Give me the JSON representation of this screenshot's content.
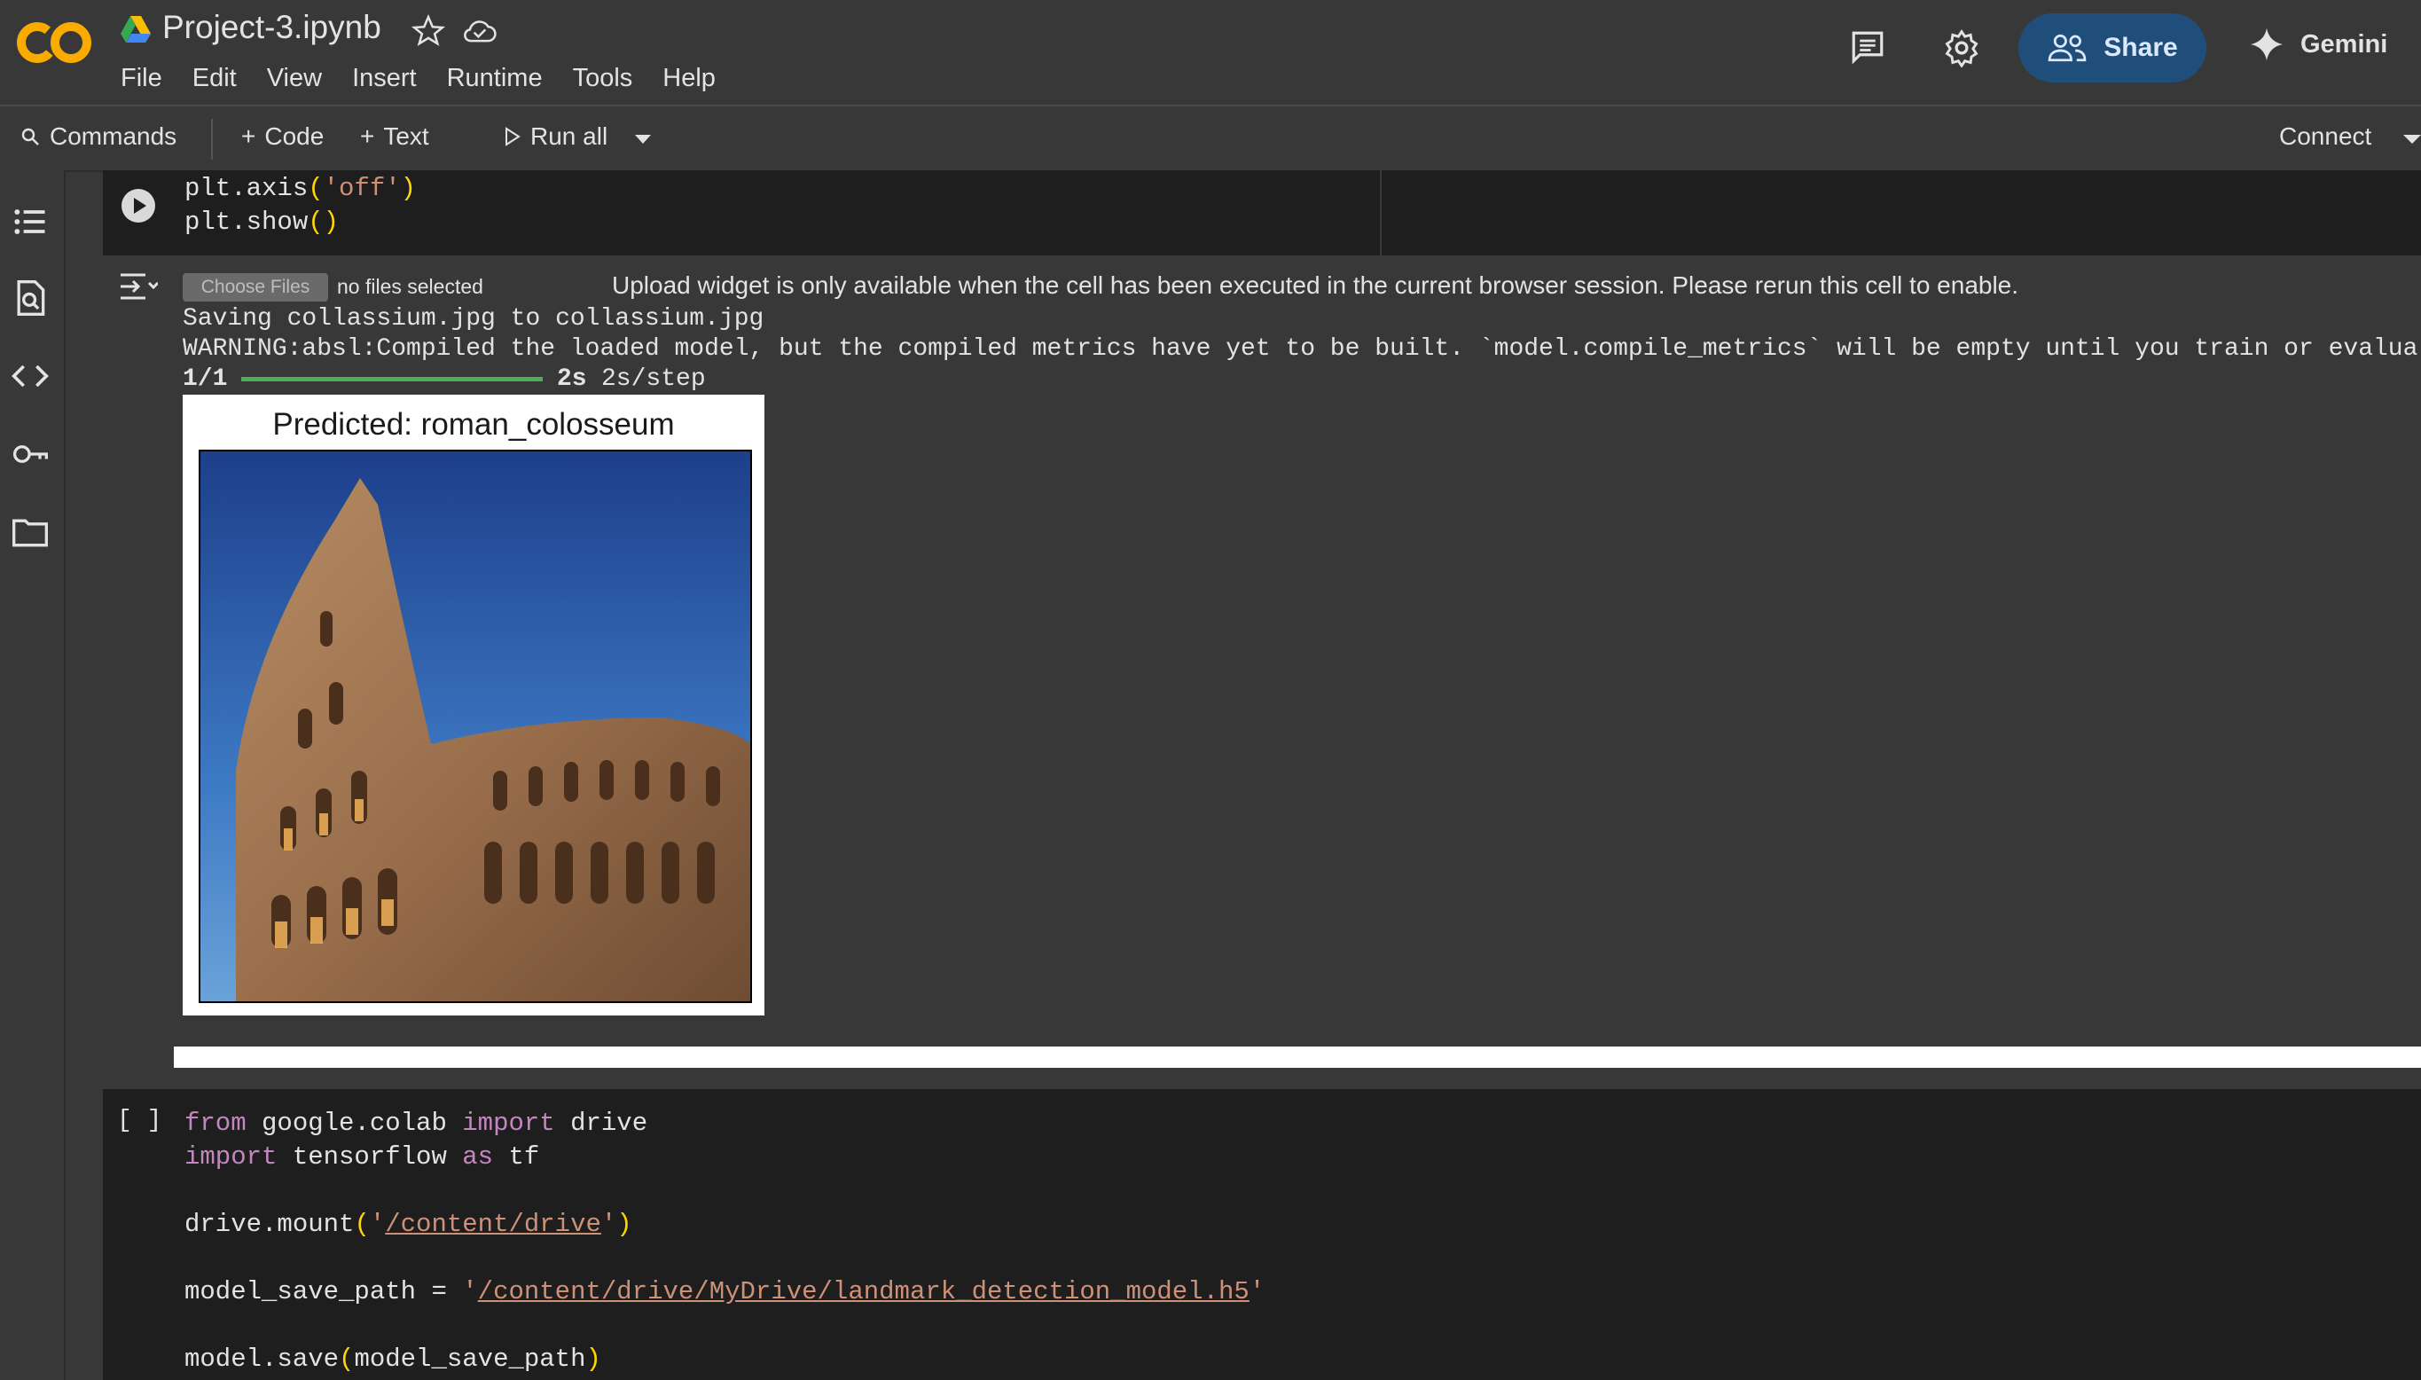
{
  "app": {
    "title": "Project-3.ipynb",
    "logo_text": "CO"
  },
  "menu": [
    "File",
    "Edit",
    "View",
    "Insert",
    "Runtime",
    "Tools",
    "Help"
  ],
  "header_actions": {
    "share_label": "Share",
    "gemini_label": "Gemini"
  },
  "toolbar": {
    "commands_label": "Commands",
    "code_label": "Code",
    "text_label": "Text",
    "run_all_label": "Run all",
    "connect_label": "Connect"
  },
  "sidebar_icons": [
    "table-of-contents-icon",
    "find-icon",
    "code-snippets-icon",
    "secrets-key-icon",
    "files-folder-icon"
  ],
  "cell1": {
    "lines": [
      "plt.axis('off')",
      "plt.show()"
    ]
  },
  "output": {
    "choose_files_label": "Choose Files",
    "no_files_text": "no files selected",
    "upload_message": "Upload widget is only available when the cell has been executed in the current browser session. Please rerun this cell to enable.",
    "saving_line": "Saving collassium.jpg to collassium.jpg",
    "warning_line": "WARNING:absl:Compiled the loaded model, but the compiled metrics have yet to be built. `model.compile_metrics` will be empty until you train or evalua",
    "progress_count": "1/1",
    "progress_fraction": 1.0,
    "progress_time": "2s",
    "progress_step": "2s/step",
    "figure_title": "Predicted: roman_colosseum"
  },
  "cell2": {
    "run_brackets": "[ ]",
    "lines": [
      "from google.colab import drive",
      "import tensorflow as tf",
      "",
      "drive.mount('/content/drive')",
      "",
      "model_save_path = '/content/drive/MyDrive/landmark_detection_model.h5'",
      "",
      "model.save(model_save_path)"
    ]
  },
  "colors": {
    "background": "#383838",
    "cell_bg": "#1e1e1e",
    "share_bg": "#1f4e7a",
    "keyword": "#c586c0",
    "string": "#ce9178",
    "paren": "#ffd700",
    "progress": "#4caf50"
  }
}
